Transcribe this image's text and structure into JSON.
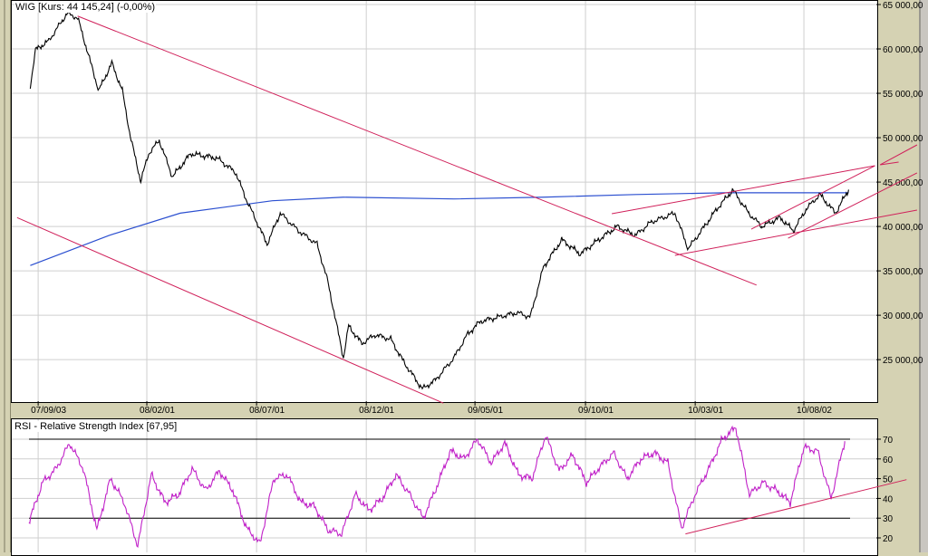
{
  "main_title": "WIG [Kurs: 44 145,24] (-0,00%)",
  "rsi_title": "RSI - Relative Strength Index [67,95]",
  "colors": {
    "price": "#000000",
    "ma": "#2b4fd0",
    "trend": "#d0205a",
    "rsi": "#c020c8",
    "grid": "#cfcfcf"
  },
  "chart_data": [
    {
      "type": "line",
      "title": "WIG [Kurs: 44 145,24] (-0,00%)",
      "x_unit": "decimal year",
      "ylim": [
        20000,
        65000
      ],
      "y_ticks": [
        "65 000,00",
        "60 000,00",
        "55 000,00",
        "50 000,00",
        "45 000,00",
        "40 000,00",
        "35 000,00",
        "30 000,00",
        "25 000,00"
      ],
      "y_tick_values": [
        65000,
        60000,
        55000,
        50000,
        45000,
        40000,
        35000,
        30000,
        25000
      ],
      "x_ticks": [
        {
          "label": "07/09/03",
          "x": 2007.67
        },
        {
          "label": "08/02/01",
          "x": 2008.083
        },
        {
          "label": "08/07/01",
          "x": 2008.5
        },
        {
          "label": "08/12/01",
          "x": 2008.917
        },
        {
          "label": "09/05/01",
          "x": 2009.33
        },
        {
          "label": "09/10/01",
          "x": 2009.75
        },
        {
          "label": "10/03/01",
          "x": 2010.167
        },
        {
          "label": "10/08/02",
          "x": 2010.58
        }
      ],
      "grid": true,
      "series": [
        {
          "name": "WIG",
          "points": [
            [
              2007.64,
              55800
            ],
            [
              2007.66,
              59900
            ],
            [
              2007.71,
              60900
            ],
            [
              2007.78,
              64000
            ],
            [
              2007.82,
              63500
            ],
            [
              2007.87,
              58400
            ],
            [
              2007.9,
              55300
            ],
            [
              2007.95,
              58400
            ],
            [
              2007.99,
              55300
            ],
            [
              2008.02,
              50200
            ],
            [
              2008.06,
              45100
            ],
            [
              2008.09,
              48200
            ],
            [
              2008.13,
              49700
            ],
            [
              2008.18,
              45600
            ],
            [
              2008.25,
              48200
            ],
            [
              2008.35,
              47700
            ],
            [
              2008.42,
              46100
            ],
            [
              2008.46,
              43100
            ],
            [
              2008.54,
              38000
            ],
            [
              2008.59,
              41500
            ],
            [
              2008.66,
              39500
            ],
            [
              2008.73,
              38000
            ],
            [
              2008.77,
              33900
            ],
            [
              2008.83,
              25200
            ],
            [
              2008.85,
              28800
            ],
            [
              2008.9,
              26800
            ],
            [
              2008.95,
              27800
            ],
            [
              2009.01,
              27300
            ],
            [
              2009.06,
              24700
            ],
            [
              2009.13,
              21700
            ],
            [
              2009.18,
              22700
            ],
            [
              2009.25,
              25200
            ],
            [
              2009.3,
              27800
            ],
            [
              2009.35,
              29300
            ],
            [
              2009.42,
              29800
            ],
            [
              2009.49,
              30300
            ],
            [
              2009.54,
              29800
            ],
            [
              2009.59,
              35400
            ],
            [
              2009.66,
              38500
            ],
            [
              2009.73,
              36900
            ],
            [
              2009.8,
              38500
            ],
            [
              2009.87,
              40000
            ],
            [
              2009.94,
              39000
            ],
            [
              2010.0,
              40500
            ],
            [
              2010.09,
              41500
            ],
            [
              2010.14,
              37500
            ],
            [
              2010.19,
              39500
            ],
            [
              2010.25,
              42000
            ],
            [
              2010.31,
              44100
            ],
            [
              2010.37,
              41500
            ],
            [
              2010.42,
              40000
            ],
            [
              2010.49,
              41000
            ],
            [
              2010.54,
              39500
            ],
            [
              2010.59,
              42000
            ],
            [
              2010.64,
              43600
            ],
            [
              2010.7,
              41500
            ],
            [
              2010.75,
              44145
            ]
          ]
        },
        {
          "name": "Moving average",
          "points": [
            [
              2007.64,
              35600
            ],
            [
              2007.94,
              39000
            ],
            [
              2008.21,
              41500
            ],
            [
              2008.56,
              42900
            ],
            [
              2008.83,
              43300
            ],
            [
              2009.25,
              43100
            ],
            [
              2009.59,
              43300
            ],
            [
              2009.94,
              43600
            ],
            [
              2010.28,
              43800
            ],
            [
              2010.75,
              43800
            ]
          ]
        }
      ],
      "trendlines": [
        [
          [
            2007.82,
            63700
          ],
          [
            2010.4,
            33400
          ]
        ],
        [
          [
            2007.59,
            41000
          ],
          [
            2009.21,
            20100
          ]
        ],
        [
          [
            2009.85,
            41440
          ],
          [
            2010.85,
            46840
          ]
        ],
        [
          [
            2010.87,
            46950
          ],
          [
            2011.01,
            49190
          ]
        ],
        [
          [
            2010.87,
            46950
          ],
          [
            2010.94,
            47250
          ]
        ],
        [
          [
            2010.38,
            39700
          ],
          [
            2010.85,
            46840
          ]
        ],
        [
          [
            2010.52,
            38680
          ],
          [
            2011.01,
            46030
          ]
        ],
        [
          [
            2010.09,
            36750
          ],
          [
            2011.01,
            41850
          ]
        ]
      ]
    },
    {
      "type": "line",
      "title": "RSI - Relative Strength Index [67,95]",
      "ylim": [
        13,
        80
      ],
      "y_ticks": [
        "70",
        "60",
        "50",
        "40",
        "30",
        "20"
      ],
      "y_tick_values": [
        70,
        60,
        50,
        40,
        30,
        20
      ],
      "reference_lines": [
        70,
        30
      ],
      "series": [
        {
          "name": "RSI",
          "x_start": 2007.635,
          "x_end": 2010.735,
          "values": [
            28,
            48,
            55,
            68,
            55,
            24,
            50,
            38,
            16,
            52,
            38,
            42,
            55,
            44,
            54,
            44,
            25,
            17,
            50,
            52,
            38,
            36,
            24,
            22,
            42,
            34,
            40,
            52,
            42,
            30,
            46,
            64,
            60,
            70,
            58,
            68,
            52,
            50,
            72,
            54,
            62,
            48,
            56,
            63,
            50,
            60,
            63,
            58,
            25,
            42,
            55,
            70,
            76,
            42,
            48,
            44,
            38,
            66,
            64,
            40,
            69
          ]
        }
      ],
      "trendlines": [
        [
          [
            2010.13,
            22
          ],
          [
            2010.97,
            49.5
          ]
        ]
      ]
    }
  ]
}
